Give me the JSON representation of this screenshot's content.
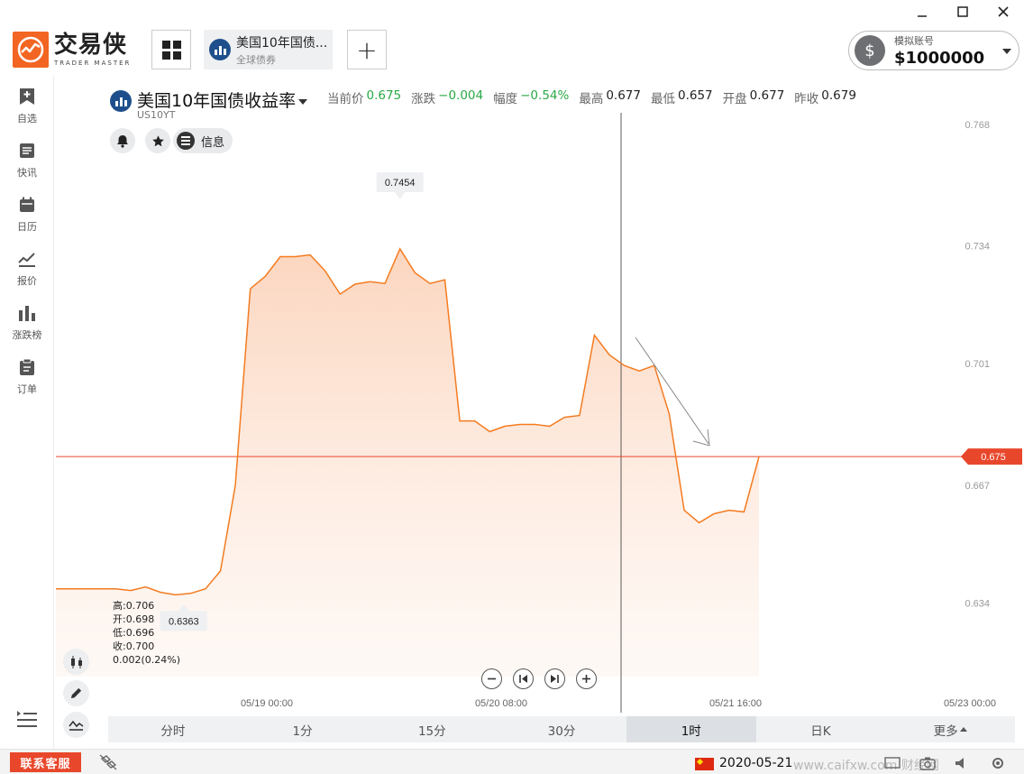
{
  "app": {
    "logo_cn": "交易侠",
    "logo_en": "TRADER MASTER"
  },
  "tab": {
    "title": "美国10年国债...",
    "subtitle": "全球债券"
  },
  "account": {
    "label": "模拟账号",
    "value": "$1000000"
  },
  "sidebar": {
    "items": [
      {
        "label": "自选",
        "icon": "bookmark-add-icon"
      },
      {
        "label": "快讯",
        "icon": "news-icon"
      },
      {
        "label": "日历",
        "icon": "calendar-icon"
      },
      {
        "label": "报价",
        "icon": "quote-line-icon"
      },
      {
        "label": "涨跌榜",
        "icon": "bar-chart-icon"
      },
      {
        "label": "订单",
        "icon": "clipboard-icon"
      }
    ]
  },
  "symbol": {
    "name": "美国10年国债收益率",
    "code": "US10YT"
  },
  "quote": {
    "current_label": "当前价",
    "current": "0.675",
    "change_label": "涨跌",
    "change": "−0.004",
    "range_label": "幅度",
    "range": "−0.54%",
    "high_label": "最高",
    "high": "0.677",
    "low_label": "最低",
    "low": "0.657",
    "open_label": "开盘",
    "open": "0.677",
    "prev_label": "昨收",
    "prev": "0.679"
  },
  "info_button": "信息",
  "ohlc": {
    "high": "高:0.706",
    "open": "开:0.698",
    "low": "低:0.696",
    "close": "收:0.700",
    "change": "0.002(0.24%)"
  },
  "chart_data": {
    "type": "area",
    "x_tick_labels": [
      "05/19 00:00",
      "05/20 08:00",
      "05/21 16:00",
      "05/23 00:00"
    ],
    "y_tick_labels": [
      "0.768",
      "0.734",
      "0.701",
      "0.667",
      "0.634"
    ],
    "ylim": [
      0.6172,
      0.768
    ],
    "values": [
      0.638,
      0.638,
      0.638,
      0.638,
      0.638,
      0.6375,
      0.6385,
      0.637,
      0.6363,
      0.6367,
      0.638,
      0.643,
      0.667,
      0.722,
      0.7255,
      0.731,
      0.731,
      0.7315,
      0.727,
      0.7205,
      0.7233,
      0.724,
      0.7235,
      0.7332,
      0.7265,
      0.7235,
      0.7245,
      0.685,
      0.685,
      0.682,
      0.6835,
      0.684,
      0.684,
      0.6835,
      0.686,
      0.6865,
      0.709,
      0.7035,
      0.7005,
      0.699,
      0.7005,
      0.687,
      0.66,
      0.6565,
      0.659,
      0.66,
      0.6595,
      0.675
    ],
    "current_price": "0.675",
    "max_label": "0.7454",
    "min_label": "0.6363",
    "line_color": "#f47b20",
    "price_line_color": "#e8472b"
  },
  "periods": [
    {
      "label": "分时",
      "active": false
    },
    {
      "label": "1分",
      "active": false
    },
    {
      "label": "15分",
      "active": false
    },
    {
      "label": "30分",
      "active": false
    },
    {
      "label": "1时",
      "active": true
    },
    {
      "label": "日K",
      "active": false
    },
    {
      "label": "更多",
      "active": false
    }
  ],
  "status": {
    "support": "联系客服",
    "datetime": "2020-05-21",
    "watermark": "www.caifxw.com 财经网"
  }
}
